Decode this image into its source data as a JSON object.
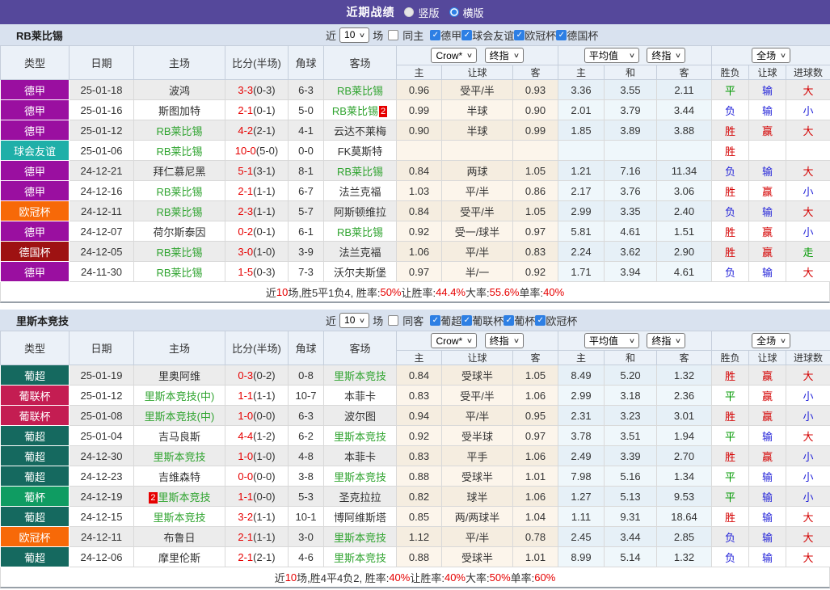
{
  "topbar": {
    "title": "近期战绩",
    "layout_options": [
      {
        "label": "竖版",
        "selected": false
      },
      {
        "label": "横版",
        "selected": true
      }
    ]
  },
  "columns": {
    "type": "类型",
    "date": "日期",
    "home": "主场",
    "score": "比分(半场)",
    "corner": "角球",
    "away": "客场",
    "dd_crow": "Crow*",
    "dd_final": "终指",
    "dd_avg": "平均值",
    "dd_scope": "全场",
    "sub": [
      "主",
      "让球",
      "客",
      "主",
      "和",
      "客",
      "胜负",
      "让球",
      "进球数"
    ]
  },
  "colors": {
    "topbar": "#55489B",
    "section_bar": "#D9E2EF",
    "checkbox_blue": "#2D7FE4",
    "win_red": "#D40000",
    "lose_blue": "#2626D9",
    "draw_green": "#009900",
    "self_team_green": "#2FA32F",
    "score_red": "#E60000"
  },
  "league_colors": {
    "德甲": "#9A0FA0",
    "球会友谊": "#1FAFA8",
    "欧冠杯": "#F76908",
    "德国杯": "#9E1212",
    "葡超": "#15695F",
    "葡联杯": "#C41D52",
    "葡杯": "#0F9C62"
  },
  "result_colors": {
    "胜": "red",
    "负": "blue",
    "平": "green",
    "赢": "red",
    "输": "blue",
    "走": "green",
    "大": "red",
    "小": "blue"
  },
  "sections": [
    {
      "team": "RB莱比锡",
      "filter": {
        "near": "近",
        "games": "10",
        "games_suffix": "场",
        "same": "同主",
        "same_checked": false,
        "leagues": [
          {
            "label": "德甲",
            "checked": true
          },
          {
            "label": "球会友谊",
            "checked": true
          },
          {
            "label": "欧冠杯",
            "checked": true
          },
          {
            "label": "德国杯",
            "checked": true
          }
        ]
      },
      "rows": [
        {
          "type": "德甲",
          "date": "25-01-18",
          "home": "波鸿",
          "home_self": false,
          "score": "3-3",
          "half": "(0-3)",
          "corner": "6-3",
          "away": "RB莱比锡",
          "away_self": true,
          "crow_h": "0.96",
          "line": "受平/半",
          "crow_a": "0.93",
          "avg_h": "3.36",
          "avg_d": "3.55",
          "avg_a": "2.11",
          "wdl": "平",
          "handicap": "输",
          "goals": "大"
        },
        {
          "type": "德甲",
          "date": "25-01-16",
          "home": "斯图加特",
          "home_self": false,
          "score": "2-1",
          "half": "(0-1)",
          "corner": "5-0",
          "away": "RB莱比锡",
          "away_self": true,
          "away_badge": "2",
          "crow_h": "0.99",
          "line": "半球",
          "crow_a": "0.90",
          "avg_h": "2.01",
          "avg_d": "3.79",
          "avg_a": "3.44",
          "wdl": "负",
          "handicap": "输",
          "goals": "小"
        },
        {
          "type": "德甲",
          "date": "25-01-12",
          "home": "RB莱比锡",
          "home_self": true,
          "score": "4-2",
          "half": "(2-1)",
          "corner": "4-1",
          "away": "云达不莱梅",
          "away_self": false,
          "crow_h": "0.90",
          "line": "半球",
          "crow_a": "0.99",
          "avg_h": "1.85",
          "avg_d": "3.89",
          "avg_a": "3.88",
          "wdl": "胜",
          "handicap": "赢",
          "goals": "大"
        },
        {
          "type": "球会友谊",
          "date": "25-01-06",
          "home": "RB莱比锡",
          "home_self": true,
          "score": "10-0",
          "half": "(5-0)",
          "corner": "0-0",
          "away": "FK莫斯特",
          "away_self": false,
          "crow_h": "",
          "line": "",
          "crow_a": "",
          "avg_h": "",
          "avg_d": "",
          "avg_a": "",
          "wdl": "胜",
          "handicap": "",
          "goals": ""
        },
        {
          "type": "德甲",
          "date": "24-12-21",
          "home": "拜仁慕尼黑",
          "home_self": false,
          "score": "5-1",
          "half": "(3-1)",
          "corner": "8-1",
          "away": "RB莱比锡",
          "away_self": true,
          "crow_h": "0.84",
          "line": "两球",
          "crow_a": "1.05",
          "avg_h": "1.21",
          "avg_d": "7.16",
          "avg_a": "11.34",
          "wdl": "负",
          "handicap": "输",
          "goals": "大"
        },
        {
          "type": "德甲",
          "date": "24-12-16",
          "home": "RB莱比锡",
          "home_self": true,
          "score": "2-1",
          "half": "(1-1)",
          "corner": "6-7",
          "away": "法兰克福",
          "away_self": false,
          "crow_h": "1.03",
          "line": "平/半",
          "crow_a": "0.86",
          "avg_h": "2.17",
          "avg_d": "3.76",
          "avg_a": "3.06",
          "wdl": "胜",
          "handicap": "赢",
          "goals": "小"
        },
        {
          "type": "欧冠杯",
          "date": "24-12-11",
          "home": "RB莱比锡",
          "home_self": true,
          "score": "2-3",
          "half": "(1-1)",
          "corner": "5-7",
          "away": "阿斯顿维拉",
          "away_self": false,
          "crow_h": "0.84",
          "line": "受平/半",
          "crow_a": "1.05",
          "avg_h": "2.99",
          "avg_d": "3.35",
          "avg_a": "2.40",
          "wdl": "负",
          "handicap": "输",
          "goals": "大"
        },
        {
          "type": "德甲",
          "date": "24-12-07",
          "home": "荷尔斯泰因",
          "home_self": false,
          "score": "0-2",
          "half": "(0-1)",
          "corner": "6-1",
          "away": "RB莱比锡",
          "away_self": true,
          "crow_h": "0.92",
          "line": "受一/球半",
          "crow_a": "0.97",
          "avg_h": "5.81",
          "avg_d": "4.61",
          "avg_a": "1.51",
          "wdl": "胜",
          "handicap": "赢",
          "goals": "小"
        },
        {
          "type": "德国杯",
          "date": "24-12-05",
          "home": "RB莱比锡",
          "home_self": true,
          "score": "3-0",
          "half": "(1-0)",
          "corner": "3-9",
          "away": "法兰克福",
          "away_self": false,
          "crow_h": "1.06",
          "line": "平/半",
          "crow_a": "0.83",
          "avg_h": "2.24",
          "avg_d": "3.62",
          "avg_a": "2.90",
          "wdl": "胜",
          "handicap": "赢",
          "goals": "走"
        },
        {
          "type": "德甲",
          "date": "24-11-30",
          "home": "RB莱比锡",
          "home_self": true,
          "score": "1-5",
          "half": "(0-3)",
          "corner": "7-3",
          "away": "沃尔夫斯堡",
          "away_self": false,
          "crow_h": "0.97",
          "line": "半/一",
          "crow_a": "0.92",
          "avg_h": "1.71",
          "avg_d": "3.94",
          "avg_a": "4.61",
          "wdl": "负",
          "handicap": "输",
          "goals": "大"
        }
      ],
      "summary": [
        {
          "t": "近"
        },
        {
          "t": "10",
          "red": true
        },
        {
          "t": "场,胜5平1负4, 胜率:"
        },
        {
          "t": "50%",
          "red": true
        },
        {
          "t": " 让胜率:"
        },
        {
          "t": "44.4%",
          "red": true
        },
        {
          "t": " 大率:"
        },
        {
          "t": "55.6%",
          "red": true
        },
        {
          "t": " 单率:"
        },
        {
          "t": "40%",
          "red": true
        }
      ]
    },
    {
      "team": "里斯本竞技",
      "filter": {
        "near": "近",
        "games": "10",
        "games_suffix": "场",
        "same": "同客",
        "same_checked": false,
        "leagues": [
          {
            "label": "葡超",
            "checked": true
          },
          {
            "label": "葡联杯",
            "checked": true
          },
          {
            "label": "葡杯",
            "checked": true
          },
          {
            "label": "欧冠杯",
            "checked": true
          }
        ]
      },
      "rows": [
        {
          "type": "葡超",
          "date": "25-01-19",
          "home": "里奥阿维",
          "home_self": false,
          "score": "0-3",
          "half": "(0-2)",
          "corner": "0-8",
          "away": "里斯本竞技",
          "away_self": true,
          "crow_h": "0.84",
          "line": "受球半",
          "crow_a": "1.05",
          "avg_h": "8.49",
          "avg_d": "5.20",
          "avg_a": "1.32",
          "wdl": "胜",
          "handicap": "赢",
          "goals": "大"
        },
        {
          "type": "葡联杯",
          "date": "25-01-12",
          "home": "里斯本竞技(中)",
          "home_self": true,
          "score": "1-1",
          "half": "(1-1)",
          "corner": "10-7",
          "away": "本菲卡",
          "away_self": false,
          "crow_h": "0.83",
          "line": "受平/半",
          "crow_a": "1.06",
          "avg_h": "2.99",
          "avg_d": "3.18",
          "avg_a": "2.36",
          "wdl": "平",
          "handicap": "赢",
          "goals": "小"
        },
        {
          "type": "葡联杯",
          "date": "25-01-08",
          "home": "里斯本竞技(中)",
          "home_self": true,
          "score": "1-0",
          "half": "(0-0)",
          "corner": "6-3",
          "away": "波尔图",
          "away_self": false,
          "crow_h": "0.94",
          "line": "平/半",
          "crow_a": "0.95",
          "avg_h": "2.31",
          "avg_d": "3.23",
          "avg_a": "3.01",
          "wdl": "胜",
          "handicap": "赢",
          "goals": "小"
        },
        {
          "type": "葡超",
          "date": "25-01-04",
          "home": "吉马良斯",
          "home_self": false,
          "score": "4-4",
          "half": "(1-2)",
          "corner": "6-2",
          "away": "里斯本竞技",
          "away_self": true,
          "crow_h": "0.92",
          "line": "受半球",
          "crow_a": "0.97",
          "avg_h": "3.78",
          "avg_d": "3.51",
          "avg_a": "1.94",
          "wdl": "平",
          "handicap": "输",
          "goals": "大"
        },
        {
          "type": "葡超",
          "date": "24-12-30",
          "home": "里斯本竞技",
          "home_self": true,
          "score": "1-0",
          "half": "(1-0)",
          "corner": "4-8",
          "away": "本菲卡",
          "away_self": false,
          "crow_h": "0.83",
          "line": "平手",
          "crow_a": "1.06",
          "avg_h": "2.49",
          "avg_d": "3.39",
          "avg_a": "2.70",
          "wdl": "胜",
          "handicap": "赢",
          "goals": "小"
        },
        {
          "type": "葡超",
          "date": "24-12-23",
          "home": "吉维森特",
          "home_self": false,
          "score": "0-0",
          "half": "(0-0)",
          "corner": "3-8",
          "away": "里斯本竞技",
          "away_self": true,
          "crow_h": "0.88",
          "line": "受球半",
          "crow_a": "1.01",
          "avg_h": "7.98",
          "avg_d": "5.16",
          "avg_a": "1.34",
          "wdl": "平",
          "handicap": "输",
          "goals": "小"
        },
        {
          "type": "葡杯",
          "date": "24-12-19",
          "home": "里斯本竞技",
          "home_self": true,
          "home_badge": "2",
          "score": "1-1",
          "half": "(0-0)",
          "corner": "5-3",
          "away": "圣克拉拉",
          "away_self": false,
          "crow_h": "0.82",
          "line": "球半",
          "crow_a": "1.06",
          "avg_h": "1.27",
          "avg_d": "5.13",
          "avg_a": "9.53",
          "wdl": "平",
          "handicap": "输",
          "goals": "小"
        },
        {
          "type": "葡超",
          "date": "24-12-15",
          "home": "里斯本竞技",
          "home_self": true,
          "score": "3-2",
          "half": "(1-1)",
          "corner": "10-1",
          "away": "博阿维斯塔",
          "away_self": false,
          "crow_h": "0.85",
          "line": "两/两球半",
          "crow_a": "1.04",
          "avg_h": "1.11",
          "avg_d": "9.31",
          "avg_a": "18.64",
          "wdl": "胜",
          "handicap": "输",
          "goals": "大"
        },
        {
          "type": "欧冠杯",
          "date": "24-12-11",
          "home": "布鲁日",
          "home_self": false,
          "score": "2-1",
          "half": "(1-1)",
          "corner": "3-0",
          "away": "里斯本竞技",
          "away_self": true,
          "crow_h": "1.12",
          "line": "平/半",
          "crow_a": "0.78",
          "avg_h": "2.45",
          "avg_d": "3.44",
          "avg_a": "2.85",
          "wdl": "负",
          "handicap": "输",
          "goals": "大"
        },
        {
          "type": "葡超",
          "date": "24-12-06",
          "home": "摩里伦斯",
          "home_self": false,
          "score": "2-1",
          "half": "(2-1)",
          "corner": "4-6",
          "away": "里斯本竞技",
          "away_self": true,
          "crow_h": "0.88",
          "line": "受球半",
          "crow_a": "1.01",
          "avg_h": "8.99",
          "avg_d": "5.14",
          "avg_a": "1.32",
          "wdl": "负",
          "handicap": "输",
          "goals": "大"
        }
      ],
      "summary": [
        {
          "t": "近"
        },
        {
          "t": "10",
          "red": true
        },
        {
          "t": "场,胜4平4负2, 胜率:"
        },
        {
          "t": "40%",
          "red": true
        },
        {
          "t": " 让胜率:"
        },
        {
          "t": "40%",
          "red": true
        },
        {
          "t": " 大率:"
        },
        {
          "t": "50%",
          "red": true
        },
        {
          "t": " 单率:"
        },
        {
          "t": "60%",
          "red": true
        }
      ]
    }
  ]
}
